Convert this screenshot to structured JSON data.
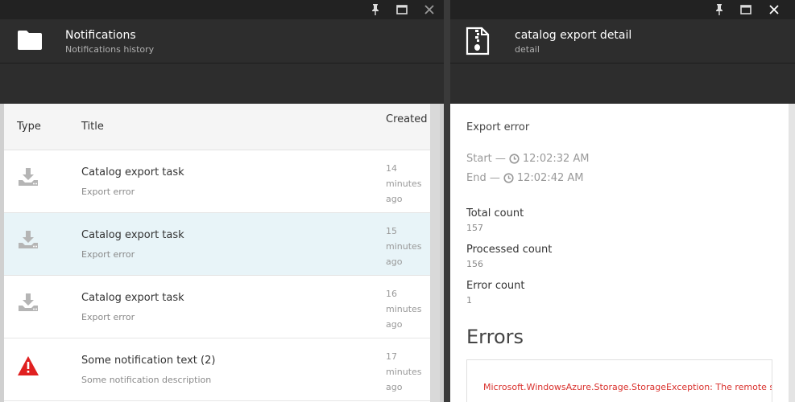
{
  "left_blade": {
    "title": "Notifications",
    "subtitle": "Notifications history",
    "columns": {
      "type": "Type",
      "title": "Title",
      "created": "Created"
    },
    "rows": [
      {
        "icon": "download-icon",
        "title": "Catalog export task",
        "description": "Export error",
        "created": [
          "14",
          "minutes",
          "ago"
        ],
        "selected": false
      },
      {
        "icon": "download-icon",
        "title": "Catalog export task",
        "description": "Export error",
        "created": [
          "15",
          "minutes",
          "ago"
        ],
        "selected": true
      },
      {
        "icon": "download-icon",
        "title": "Catalog export task",
        "description": "Export error",
        "created": [
          "16",
          "minutes",
          "ago"
        ],
        "selected": false
      },
      {
        "icon": "warning-icon",
        "title": "Some notification text (2)",
        "description": "Some notification description",
        "created": [
          "17",
          "minutes",
          "ago"
        ],
        "selected": false
      }
    ]
  },
  "right_blade": {
    "title": "catalog export detail",
    "subtitle": "detail",
    "status": "Export error",
    "start_label": "Start —",
    "start_time": "12:02:32 AM",
    "end_label": "End —",
    "end_time": "12:02:42 AM",
    "total_label": "Total count",
    "total_value": "157",
    "processed_label": "Processed count",
    "processed_value": "156",
    "error_label": "Error count",
    "error_value": "1",
    "errors_heading": "Errors",
    "error_message": "Microsoft.WindowsAzure.Storage.StorageException: The remote s"
  },
  "colors": {
    "header_bg": "#2d2d2d",
    "selected_row": "#e8f4f8",
    "error_text": "#d9302c",
    "warning_red": "#e02020"
  }
}
